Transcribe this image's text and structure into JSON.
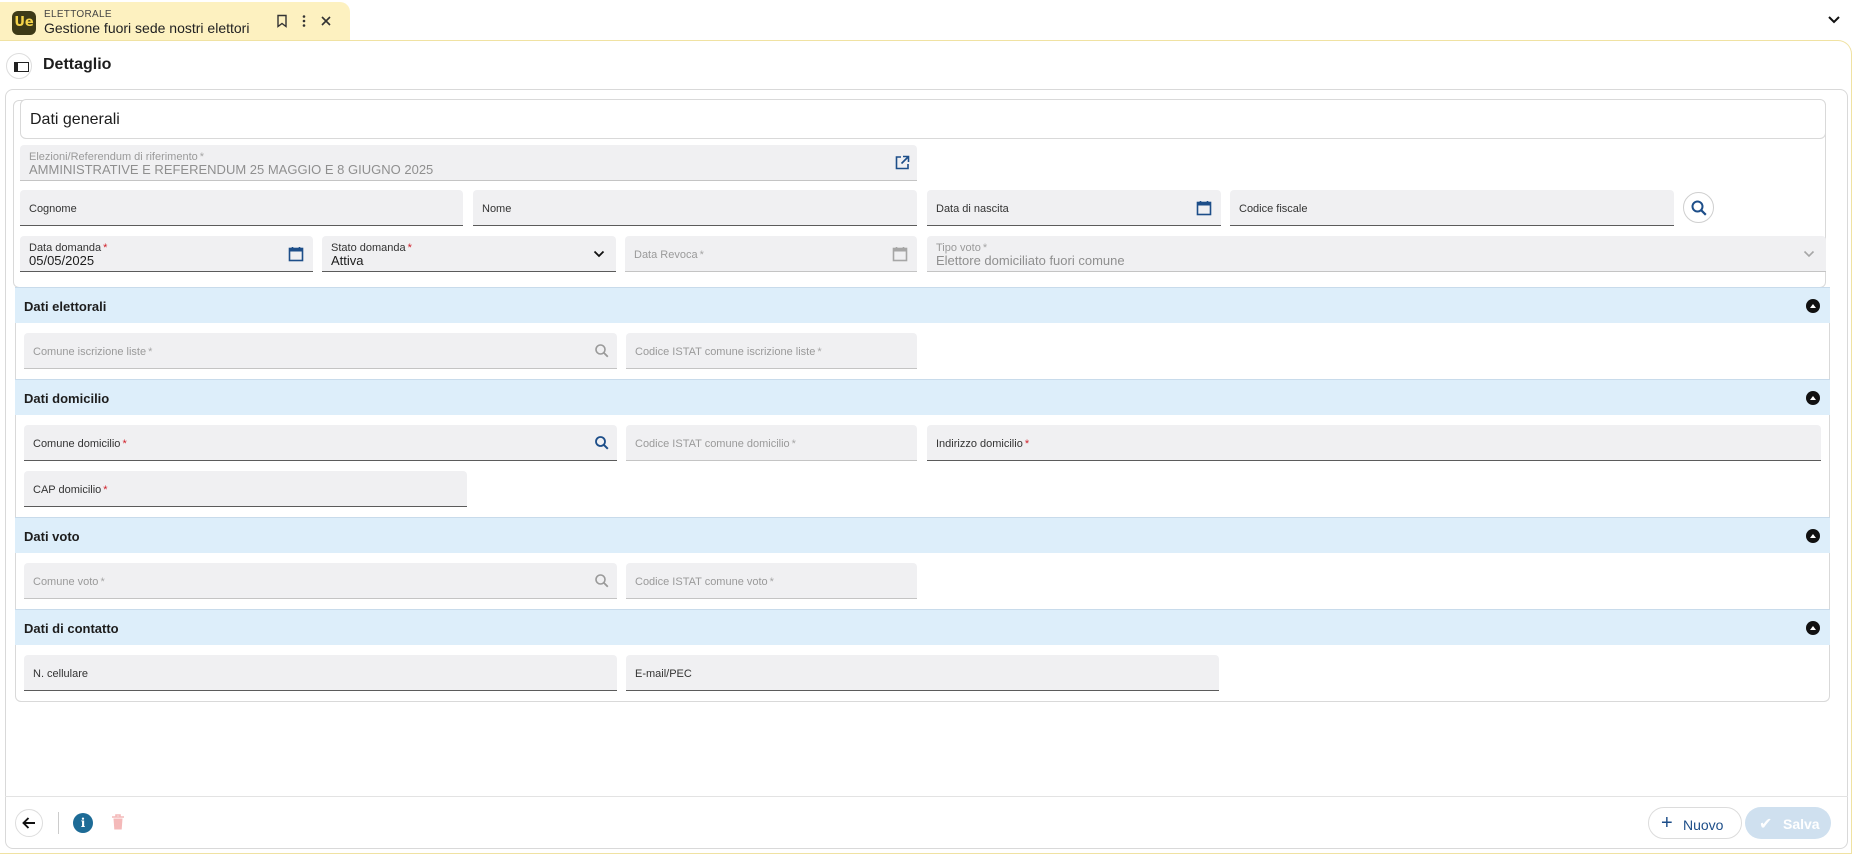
{
  "tab": {
    "section": "ELETTORALE",
    "title": "Gestione fuori sede nostri elettori",
    "logo_text": "Ue"
  },
  "header": {
    "title": "Dettaglio"
  },
  "dati_generali": {
    "title": "Dati generali",
    "elezione": {
      "label": "Elezioni/Referendum di riferimento",
      "value": "AMMINISTRATIVE E REFERENDUM 25 MAGGIO E 8 GIUGNO 2025",
      "disabled": true,
      "required": true
    },
    "cognome": {
      "label": "Cognome",
      "value": ""
    },
    "nome": {
      "label": "Nome",
      "value": ""
    },
    "data_nascita": {
      "label": "Data di nascita",
      "value": ""
    },
    "codice_fiscale": {
      "label": "Codice fiscale",
      "value": ""
    },
    "data_domanda": {
      "label": "Data domanda",
      "value": "05/05/2025",
      "required": true
    },
    "stato_domanda": {
      "label": "Stato domanda",
      "value": "Attiva",
      "required": true
    },
    "data_revoca": {
      "label": "Data Revoca",
      "value": "",
      "disabled": true,
      "required": true
    },
    "tipo_voto": {
      "label": "Tipo voto",
      "value": "Elettore domiciliato fuori comune",
      "disabled": true,
      "required": true
    }
  },
  "dati_elettorali": {
    "title": "Dati elettorali",
    "comune_iscrizione": {
      "label": "Comune iscrizione liste",
      "disabled": true,
      "required": true
    },
    "istat_iscrizione": {
      "label": "Codice ISTAT comune iscrizione liste",
      "disabled": true,
      "required": true
    }
  },
  "dati_domicilio": {
    "title": "Dati domicilio",
    "comune_domicilio": {
      "label": "Comune domicilio",
      "required": true
    },
    "istat_domicilio": {
      "label": "Codice ISTAT comune domicilio",
      "disabled": true,
      "required": true
    },
    "indirizzo_domicilio": {
      "label": "Indirizzo domicilio",
      "required": true
    },
    "cap_domicilio": {
      "label": "CAP domicilio",
      "required": true
    }
  },
  "dati_voto": {
    "title": "Dati voto",
    "comune_voto": {
      "label": "Comune voto",
      "disabled": true,
      "required": true
    },
    "istat_voto": {
      "label": "Codice ISTAT comune voto",
      "disabled": true,
      "required": true
    }
  },
  "dati_contatto": {
    "title": "Dati di contatto",
    "cellulare": {
      "label": "N. cellulare"
    },
    "email": {
      "label": "E-mail/PEC"
    }
  },
  "footer": {
    "info_glyph": "i",
    "new_label": "Nuovo",
    "save_label": "Salva"
  },
  "colors": {
    "tab_bg": "#fdf1c0",
    "section_bg": "#ddeefa",
    "field_bg": "#f0f0f2",
    "accent": "#1d4e89",
    "required": "#d0202a"
  },
  "icons": {
    "star": "*"
  }
}
